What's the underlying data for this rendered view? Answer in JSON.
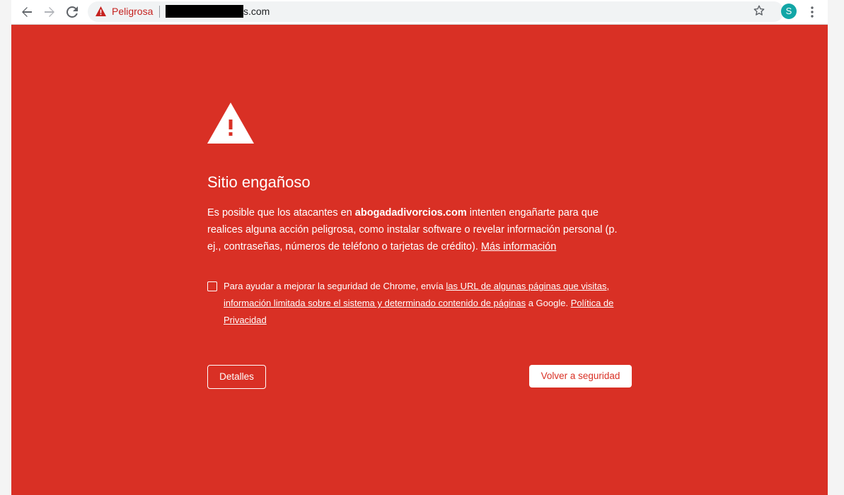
{
  "toolbar": {
    "back_icon": "arrow-left-icon",
    "forward_icon": "arrow-right-icon",
    "reload_icon": "reload-icon",
    "omnibox": {
      "security_icon": "warning-triangle-icon",
      "security_label": "Peligrosa",
      "url_visible": "s.com",
      "url_redacted": true
    },
    "bookmark_icon": "star-icon",
    "profile_initial": "S",
    "menu_icon": "kebab-menu-icon"
  },
  "interstitial": {
    "warning_icon": "warning-triangle-icon",
    "title": "Sitio engañoso",
    "body_prefix": "Es posible que los atacantes en ",
    "body_site": "abogadadivorcios.com",
    "body_suffix": " intenten engañarte para que realices alguna acción peligrosa, como instalar software o revelar información personal (p. ej., contraseñas, números de teléfono o tarjetas de crédito). ",
    "learn_more_link": "Más información",
    "checkbox": {
      "checked": false,
      "text_prefix": "Para ayudar a mejorar la seguridad de Chrome, envía ",
      "link1": "las URL de algunas páginas que visitas, información limitada sobre el sistema y determinado contenido de páginas",
      "text_middle": " a Google. ",
      "link2": "Política de Privacidad"
    },
    "details_button": "Detalles",
    "back_button": "Volver a seguridad"
  },
  "colors": {
    "danger_red": "#d93025",
    "omnibox_bg": "#f1f3f4",
    "avatar_teal": "#12a6a6"
  }
}
